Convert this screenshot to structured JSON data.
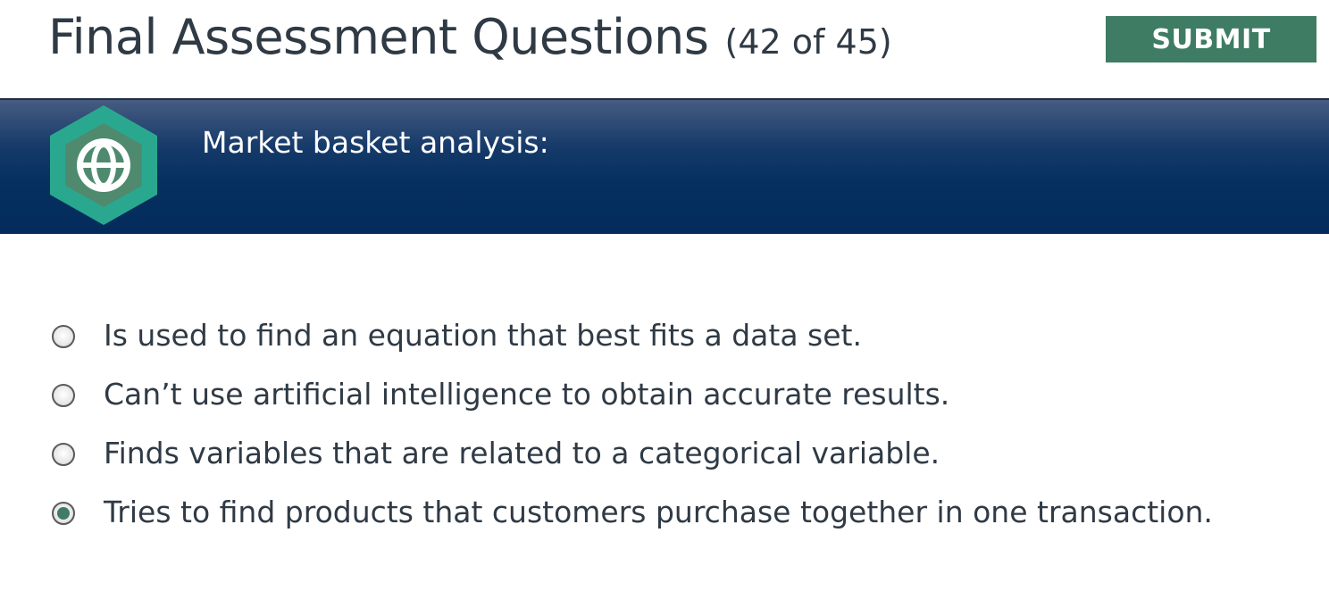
{
  "header": {
    "title": "Final Assessment Questions",
    "progress": "(42 of 45)",
    "submit_label": "SUBMIT"
  },
  "question": {
    "icon": "globe-icon",
    "text": "Market basket analysis:"
  },
  "options": [
    {
      "text": "Is used to find an equation that best fits a data set.",
      "selected": false
    },
    {
      "text": "Can’t use artificial intelligence to obtain accurate results.",
      "selected": false
    },
    {
      "text": "Finds variables that are related to a categorical variable.",
      "selected": false
    },
    {
      "text": "Tries to find products that customers purchase together in one transaction.",
      "selected": true
    }
  ],
  "colors": {
    "accent": "#3e7c63",
    "banner": "#032c5c",
    "badge_outer": "#2aa88f",
    "badge_inner": "#4f8a6e"
  }
}
